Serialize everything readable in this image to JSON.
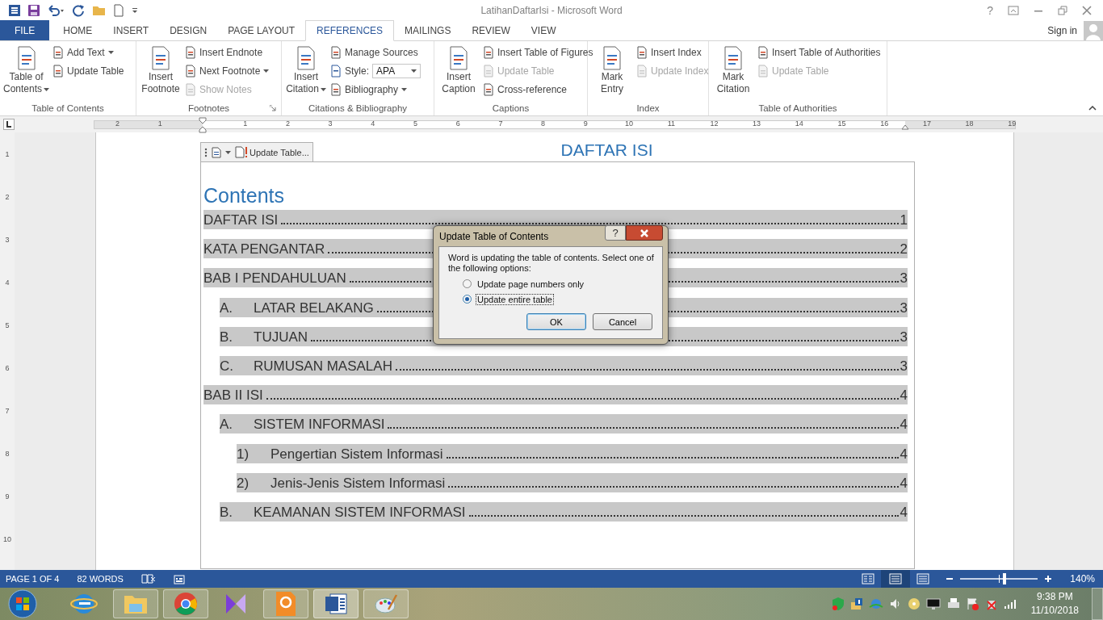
{
  "window": {
    "title": "LatihanDaftarIsi - Microsoft Word",
    "help": "?"
  },
  "tabs": [
    {
      "label": "FILE",
      "kind": "file",
      "selected": false
    },
    {
      "label": "HOME",
      "kind": "tab",
      "selected": false
    },
    {
      "label": "INSERT",
      "kind": "tab",
      "selected": false
    },
    {
      "label": "DESIGN",
      "kind": "tab",
      "selected": false
    },
    {
      "label": "PAGE LAYOUT",
      "kind": "tab",
      "selected": false
    },
    {
      "label": "REFERENCES",
      "kind": "tab",
      "selected": true
    },
    {
      "label": "MAILINGS",
      "kind": "tab",
      "selected": false
    },
    {
      "label": "REVIEW",
      "kind": "tab",
      "selected": false
    },
    {
      "label": "VIEW",
      "kind": "tab",
      "selected": false
    }
  ],
  "account": {
    "sign_in": "Sign in"
  },
  "ribbon": {
    "groups": [
      {
        "label": "Table of Contents",
        "launcher": false,
        "large": {
          "label": "Table of\nContents",
          "dropdown": true
        },
        "small": [
          {
            "kind": "button",
            "label": "Add Text",
            "dropdown": true,
            "disabled": false
          },
          {
            "kind": "button",
            "label": "Update Table",
            "dropdown": false,
            "disabled": false
          }
        ]
      },
      {
        "label": "Footnotes",
        "launcher": true,
        "large": {
          "label": "Insert\nFootnote",
          "dropdown": false
        },
        "small": [
          {
            "kind": "button",
            "label": "Insert Endnote",
            "dropdown": false,
            "disabled": false
          },
          {
            "kind": "button",
            "label": "Next Footnote",
            "dropdown": true,
            "disabled": false
          },
          {
            "kind": "button",
            "label": "Show Notes",
            "dropdown": false,
            "disabled": true
          }
        ]
      },
      {
        "label": "Citations & Bibliography",
        "launcher": false,
        "large": {
          "label": "Insert\nCitation",
          "dropdown": true
        },
        "small": [
          {
            "kind": "button",
            "label": "Manage Sources",
            "dropdown": false,
            "disabled": false
          },
          {
            "kind": "select",
            "label": "Style:",
            "value": "APA"
          },
          {
            "kind": "button",
            "label": "Bibliography",
            "dropdown": true,
            "disabled": false
          }
        ]
      },
      {
        "label": "Captions",
        "launcher": false,
        "large": {
          "label": "Insert\nCaption",
          "dropdown": false
        },
        "small": [
          {
            "kind": "button",
            "label": "Insert Table of Figures",
            "dropdown": false,
            "disabled": false
          },
          {
            "kind": "button",
            "label": "Update Table",
            "dropdown": false,
            "disabled": true
          },
          {
            "kind": "button",
            "label": "Cross-reference",
            "dropdown": false,
            "disabled": false
          }
        ]
      },
      {
        "label": "Index",
        "launcher": false,
        "large": {
          "label": "Mark\nEntry",
          "dropdown": false
        },
        "small": [
          {
            "kind": "button",
            "label": "Insert Index",
            "dropdown": false,
            "disabled": false
          },
          {
            "kind": "button",
            "label": "Update Index",
            "dropdown": false,
            "disabled": true
          }
        ]
      },
      {
        "label": "Table of Authorities",
        "launcher": false,
        "large": {
          "label": "Mark\nCitation",
          "dropdown": false
        },
        "small": [
          {
            "kind": "button",
            "label": "Insert Table of Authorities",
            "dropdown": false,
            "disabled": false
          },
          {
            "kind": "button",
            "label": "Update Table",
            "dropdown": false,
            "disabled": true
          }
        ]
      }
    ]
  },
  "ruler": {
    "labels": [
      "2",
      "1",
      "1",
      "2",
      "3",
      "4",
      "5",
      "6",
      "7",
      "8",
      "9",
      "10",
      "11",
      "12",
      "13",
      "14",
      "15",
      "16",
      "17",
      "18",
      "19"
    ],
    "vertical": [
      "1",
      "2",
      "3",
      "4",
      "5",
      "6",
      "7",
      "8",
      "9",
      "10"
    ]
  },
  "document": {
    "heading": "DAFTAR ISI",
    "toc_tab": {
      "label": "Update Table..."
    },
    "toc_title": "Contents",
    "entries": [
      {
        "text": "DAFTAR ISI",
        "page": "1"
      },
      {
        "text": "KATA PENGANTAR",
        "page": "2"
      },
      {
        "text": "BAB I PENDAHULUAN",
        "page": "3",
        "children": [
          {
            "number": "A.",
            "text": "LATAR BELAKANG",
            "page": "3"
          },
          {
            "number": "B.",
            "text": "TUJUAN",
            "page": "3"
          },
          {
            "number": "C.",
            "text": "RUMUSAN MASALAH",
            "page": "3"
          }
        ]
      },
      {
        "text": "BAB II ISI",
        "page": "4",
        "children": [
          {
            "number": "A.",
            "text": "SISTEM INFORMASI",
            "page": "4",
            "children": [
              {
                "number": "1)",
                "text": "Pengertian Sistem Informasi",
                "page": "4"
              },
              {
                "number": "2)",
                "text": "Jenis-Jenis Sistem Informasi",
                "page": "4"
              }
            ]
          },
          {
            "number": "B.",
            "text": "KEAMANAN SISTEM INFORMASI",
            "page": "4"
          }
        ]
      }
    ]
  },
  "dialog": {
    "title": "Update Table of Contents",
    "help": "?",
    "message": "Word is updating the table of contents.  Select one of the following options:",
    "options": [
      {
        "label": "Update page numbers only",
        "selected": false
      },
      {
        "label": "Update entire table",
        "selected": true
      }
    ],
    "buttons": [
      {
        "label": "OK",
        "default": true
      },
      {
        "label": "Cancel",
        "default": false
      }
    ]
  },
  "status_bar": {
    "page": "PAGE 1 OF 4",
    "words": "82 WORDS",
    "views": [
      {
        "selected": false
      },
      {
        "selected": true
      },
      {
        "selected": false
      }
    ],
    "zoom": {
      "level": 0.57,
      "reading": "140%"
    }
  },
  "taskbar": {
    "time": "9:38 PM",
    "date": "11/10/2018"
  }
}
